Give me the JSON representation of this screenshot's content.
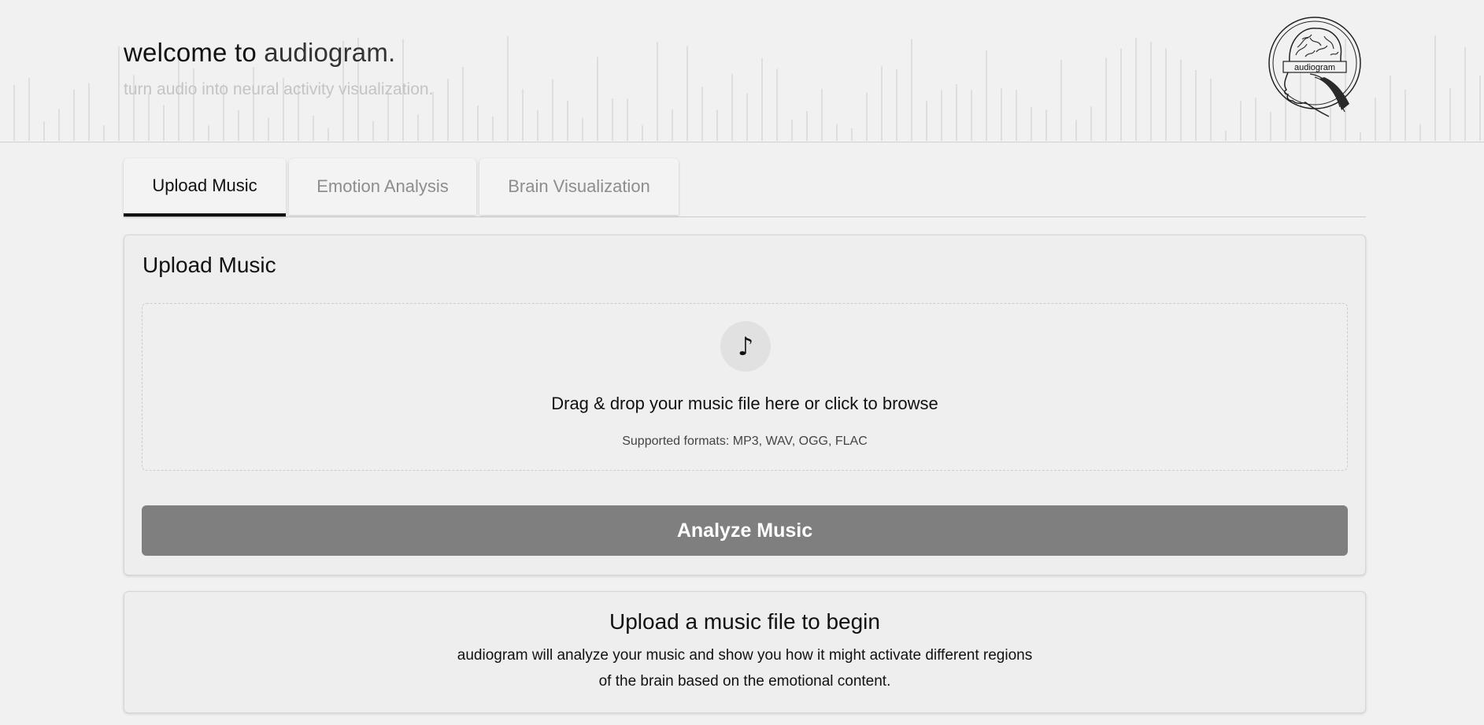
{
  "header": {
    "title_prefix": "welcome to ",
    "title_brand": "audiogram.",
    "subtitle": "turn audio into neural activity visualization.",
    "logo_text": "audiogram",
    "logo_icon": "brain-head-icon"
  },
  "tabs": [
    {
      "label": "Upload Music",
      "active": true
    },
    {
      "label": "Emotion Analysis",
      "active": false
    },
    {
      "label": "Brain Visualization",
      "active": false
    }
  ],
  "upload": {
    "title": "Upload Music",
    "icon": "music-note-icon",
    "note_glyph": "♪",
    "drop_text": "Drag & drop your music file here or click to browse",
    "formats": "Supported formats: MP3, WAV, OGG, FLAC",
    "analyze_label": "Analyze Music"
  },
  "info": {
    "title": "Upload a music file to begin",
    "line1": "audiogram will analyze your music and show you how it might activate different regions",
    "line2": "of the brain based on the emotional content."
  },
  "colors": {
    "background": "#f1f1f1",
    "button": "#7f7f7f",
    "active_tab_indicator": "#111111",
    "muted_text": "#8d8d8d"
  }
}
